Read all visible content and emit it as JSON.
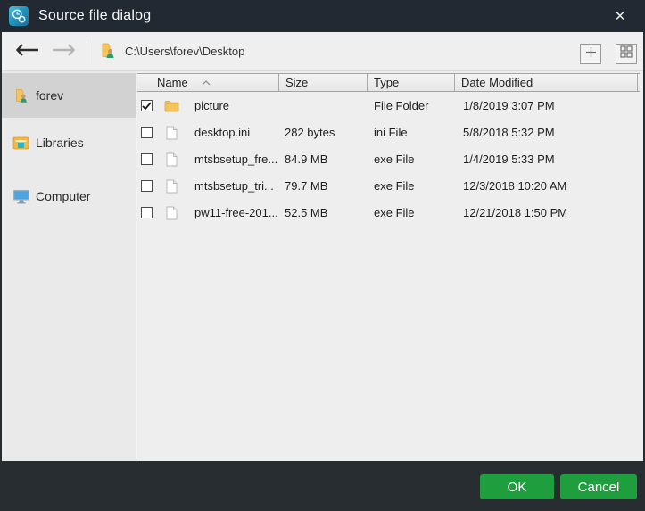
{
  "window": {
    "title": "Source file dialog"
  },
  "icons": {
    "close": "✕"
  },
  "toolbar": {
    "path": "C:\\Users\\forev\\Desktop"
  },
  "sidebar": {
    "items": [
      {
        "label": "forev",
        "icon": "user-folder-icon",
        "selected": true
      },
      {
        "label": "Libraries",
        "icon": "libraries-icon",
        "selected": false
      },
      {
        "label": "Computer",
        "icon": "computer-icon",
        "selected": false
      }
    ]
  },
  "table": {
    "columns": [
      "Name",
      "Size",
      "Type",
      "Date Modified"
    ],
    "sort": {
      "column": "Name",
      "direction": "ascending"
    },
    "rows": [
      {
        "checked": true,
        "icon": "folder-icon",
        "name": "picture",
        "size": "",
        "type": "File Folder",
        "date": "1/8/2019 3:07 PM"
      },
      {
        "checked": false,
        "icon": "file-icon",
        "name": "desktop.ini",
        "size": "282 bytes",
        "type": "ini File",
        "date": "5/8/2018 5:32 PM"
      },
      {
        "checked": false,
        "icon": "file-icon",
        "name": "mtsbsetup_fre...",
        "size": "84.9 MB",
        "type": "exe File",
        "date": "1/4/2019 5:33 PM"
      },
      {
        "checked": false,
        "icon": "file-icon",
        "name": "mtsbsetup_tri...",
        "size": "79.7 MB",
        "type": "exe File",
        "date": "12/3/2018 10:20 AM"
      },
      {
        "checked": false,
        "icon": "file-icon",
        "name": "pw11-free-201...",
        "size": "52.5 MB",
        "type": "exe File",
        "date": "12/21/2018 1:50 PM"
      }
    ]
  },
  "footer": {
    "ok_label": "OK",
    "cancel_label": "Cancel"
  },
  "colors": {
    "titlebar": "#232932",
    "footer": "#272d31",
    "button_green": "#1e9e3c",
    "app_icon_teal": "#2aa3c6",
    "toolbar_bg": "#efefef",
    "sidebar_selected": "#d2d2d2"
  }
}
